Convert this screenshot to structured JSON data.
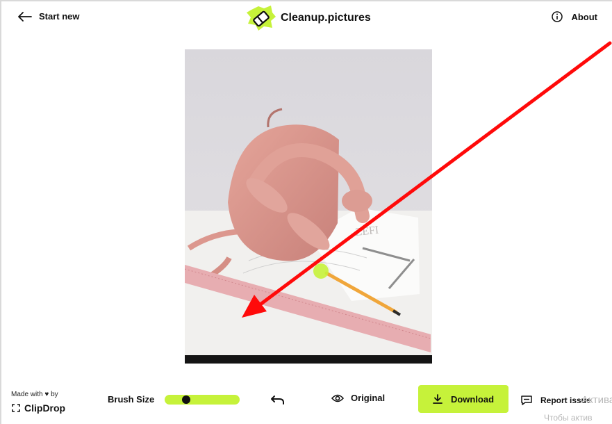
{
  "header": {
    "start_new_label": "Start new",
    "app_title": "Cleanup.pictures",
    "about_label": "About"
  },
  "footer": {
    "made_with_label": "Made with ♥ by",
    "brand_label": "ClipDrop",
    "brush_size_label": "Brush Size",
    "brush_size_value": 0.25,
    "original_label": "Original",
    "download_label": "Download",
    "report_label": "Report issue"
  },
  "system_overlay": {
    "activate_line1": "Активаци",
    "activate_line2": "Чтобы актив"
  },
  "colors": {
    "accent": "#c6f23a",
    "annotation_arrow": "#ff0a0a"
  },
  "icons": [
    "arrow-left-icon",
    "eraser-logo-icon",
    "info-icon",
    "clipdrop-icon",
    "undo-icon",
    "eye-icon",
    "download-icon",
    "chat-bubble-icon"
  ]
}
